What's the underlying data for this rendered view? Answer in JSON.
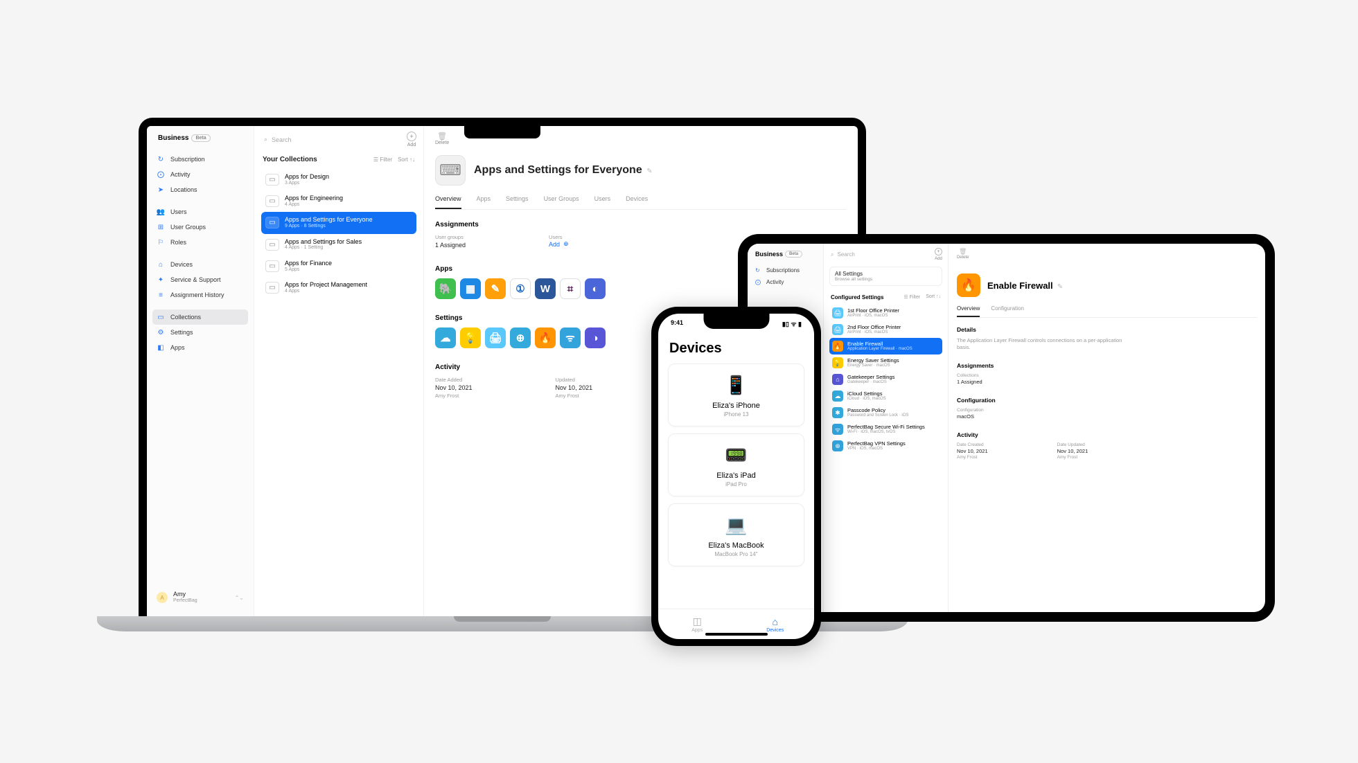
{
  "mac": {
    "brand": "Business",
    "beta": "Beta",
    "search_placeholder": "Search",
    "toolbar": {
      "add": "Add",
      "delete": "Delete"
    },
    "nav1": [
      {
        "icon": "↻",
        "label": "Subscription"
      },
      {
        "icon": "⨀",
        "label": "Activity"
      },
      {
        "icon": "➤",
        "label": "Locations"
      }
    ],
    "nav2": [
      {
        "icon": "👥",
        "label": "Users"
      },
      {
        "icon": "⊞",
        "label": "User Groups"
      },
      {
        "icon": "⚐",
        "label": "Roles"
      }
    ],
    "nav3": [
      {
        "icon": "⌂",
        "label": "Devices"
      },
      {
        "icon": "✦",
        "label": "Service & Support"
      },
      {
        "icon": "≡",
        "label": "Assignment History"
      }
    ],
    "nav4": [
      {
        "icon": "▭",
        "label": "Collections",
        "active": true
      },
      {
        "icon": "⚙",
        "label": "Settings"
      },
      {
        "icon": "◧",
        "label": "Apps"
      }
    ],
    "user": {
      "name": "Amy",
      "org": "PerfectBag"
    },
    "mid": {
      "title": "Your Collections",
      "filter": "Filter",
      "sort": "Sort",
      "items": [
        {
          "name": "Apps for Design",
          "sub": "3 Apps"
        },
        {
          "name": "Apps for Engineering",
          "sub": "4 Apps"
        },
        {
          "name": "Apps and Settings for Everyone",
          "sub": "9 Apps · 8 Settings",
          "selected": true
        },
        {
          "name": "Apps and Settings for Sales",
          "sub": "4 Apps · 1 Setting"
        },
        {
          "name": "Apps for Finance",
          "sub": "5 Apps"
        },
        {
          "name": "Apps for Project Management",
          "sub": "4 Apps"
        }
      ]
    },
    "detail": {
      "title": "Apps and Settings for Everyone",
      "tabs": [
        "Overview",
        "Apps",
        "Settings",
        "User Groups",
        "Users",
        "Devices"
      ],
      "assignments_h": "Assignments",
      "usergroups_l": "User groups",
      "usergroups_v": "1 Assigned",
      "users_l": "Users",
      "add": "Add",
      "apps_h": "Apps",
      "settings_h": "Settings",
      "activity_h": "Activity",
      "date_added_l": "Date Added",
      "date_added_v": "Nov 10, 2021",
      "date_added_by": "Amy Frost",
      "updated_l": "Updated",
      "updated_v": "Nov 10, 2021",
      "updated_by": "Amy Frost",
      "apps": [
        {
          "bg": "#3fbf4e",
          "g": "🐘"
        },
        {
          "bg": "#1e88e5",
          "g": "▦"
        },
        {
          "bg": "#ff9f0a",
          "g": "✎"
        },
        {
          "bg": "#ffffff",
          "g": "①",
          "fg": "#1565c0",
          "border": true
        },
        {
          "bg": "#2b579a",
          "g": "W"
        },
        {
          "bg": "#ffffff",
          "g": "⌗",
          "fg": "#4a154b",
          "border": true
        },
        {
          "bg": "#4a66d8",
          "g": "◐"
        }
      ],
      "settings": [
        {
          "bg": "#34aadc",
          "g": "☁"
        },
        {
          "bg": "#ffcc00",
          "g": "💡"
        },
        {
          "bg": "#5ac8fa",
          "g": "🖨"
        },
        {
          "bg": "#34aadc",
          "g": "⊕"
        },
        {
          "bg": "#ff9500",
          "g": "🔥"
        },
        {
          "bg": "#33a3dc",
          "g": "ᯤ"
        },
        {
          "bg": "#5856d6",
          "g": "◑"
        }
      ]
    }
  },
  "ipad": {
    "brand": "Business",
    "beta": "Beta",
    "search_placeholder": "Search",
    "toolbar": {
      "add": "Add",
      "delete": "Delete"
    },
    "nav": [
      {
        "icon": "↻",
        "label": "Subscriptions"
      },
      {
        "icon": "⨀",
        "label": "Activity"
      }
    ],
    "allsettings": {
      "title": "All Settings",
      "sub": "Browse all settings"
    },
    "conf_h": "Configured Settings",
    "filter": "Filter",
    "sort": "Sort",
    "items": [
      {
        "name": "1st Floor Office Printer",
        "sub": "AirPrint · iOS, macOS",
        "color": "#5ac8fa",
        "g": "🖨"
      },
      {
        "name": "2nd Floor Office Printer",
        "sub": "AirPrint · iOS, macOS",
        "color": "#5ac8fa",
        "g": "🖨"
      },
      {
        "name": "Enable Firewall",
        "sub": "Application Layer Firewall · macOS",
        "color": "#ff9500",
        "g": "🔥",
        "selected": true
      },
      {
        "name": "Energy Saver Settings",
        "sub": "Energy Saver · macOS",
        "color": "#ffcc00",
        "g": "💡"
      },
      {
        "name": "Gatekeeper Settings",
        "sub": "Gatekeeper · macOS",
        "color": "#5856d6",
        "g": "⌂"
      },
      {
        "name": "iCloud Settings",
        "sub": "iCloud · iOS, macOS",
        "color": "#34aadc",
        "g": "☁"
      },
      {
        "name": "Passcode Policy",
        "sub": "Password and Screen Lock · iOS",
        "color": "#34aadc",
        "g": "✱"
      },
      {
        "name": "PerfectBag Secure Wi-Fi Settings",
        "sub": "Wi-Fi · iOS, macOS, tvOS",
        "color": "#33a3dc",
        "g": "ᯤ"
      },
      {
        "name": "PerfectBag VPN Settings",
        "sub": "VPN · iOS, macOS",
        "color": "#33a3dc",
        "g": "⊕"
      }
    ],
    "detail": {
      "title": "Enable Firewall",
      "tabs": [
        "Overview",
        "Configuration"
      ],
      "details_h": "Details",
      "details_body": "The Application Layer Firewall controls connections on a per-application basis.",
      "assign_h": "Assignments",
      "coll_l": "Collections",
      "coll_v": "1 Assigned",
      "config_h": "Configuration",
      "config_l": "Configuration",
      "config_v": "macOS",
      "activity_h": "Activity",
      "created_l": "Date Created",
      "created_v": "Nov 10, 2021",
      "created_by": "Amy Frost",
      "updated_l": "Date Updated",
      "updated_v": "Nov 10, 2021",
      "updated_by": "Amy Frost"
    }
  },
  "iphone": {
    "time": "9:41",
    "title": "Devices",
    "cards": [
      {
        "emoji": "📱",
        "name": "Eliza's iPhone",
        "sub": "iPhone 13"
      },
      {
        "emoji": "📟",
        "name": "Eliza's iPad",
        "sub": "iPad Pro"
      },
      {
        "emoji": "💻",
        "name": "Eliza's MacBook",
        "sub": "MacBook Pro 14\""
      }
    ],
    "tabs": {
      "apps": "Apps",
      "devices": "Devices"
    }
  }
}
